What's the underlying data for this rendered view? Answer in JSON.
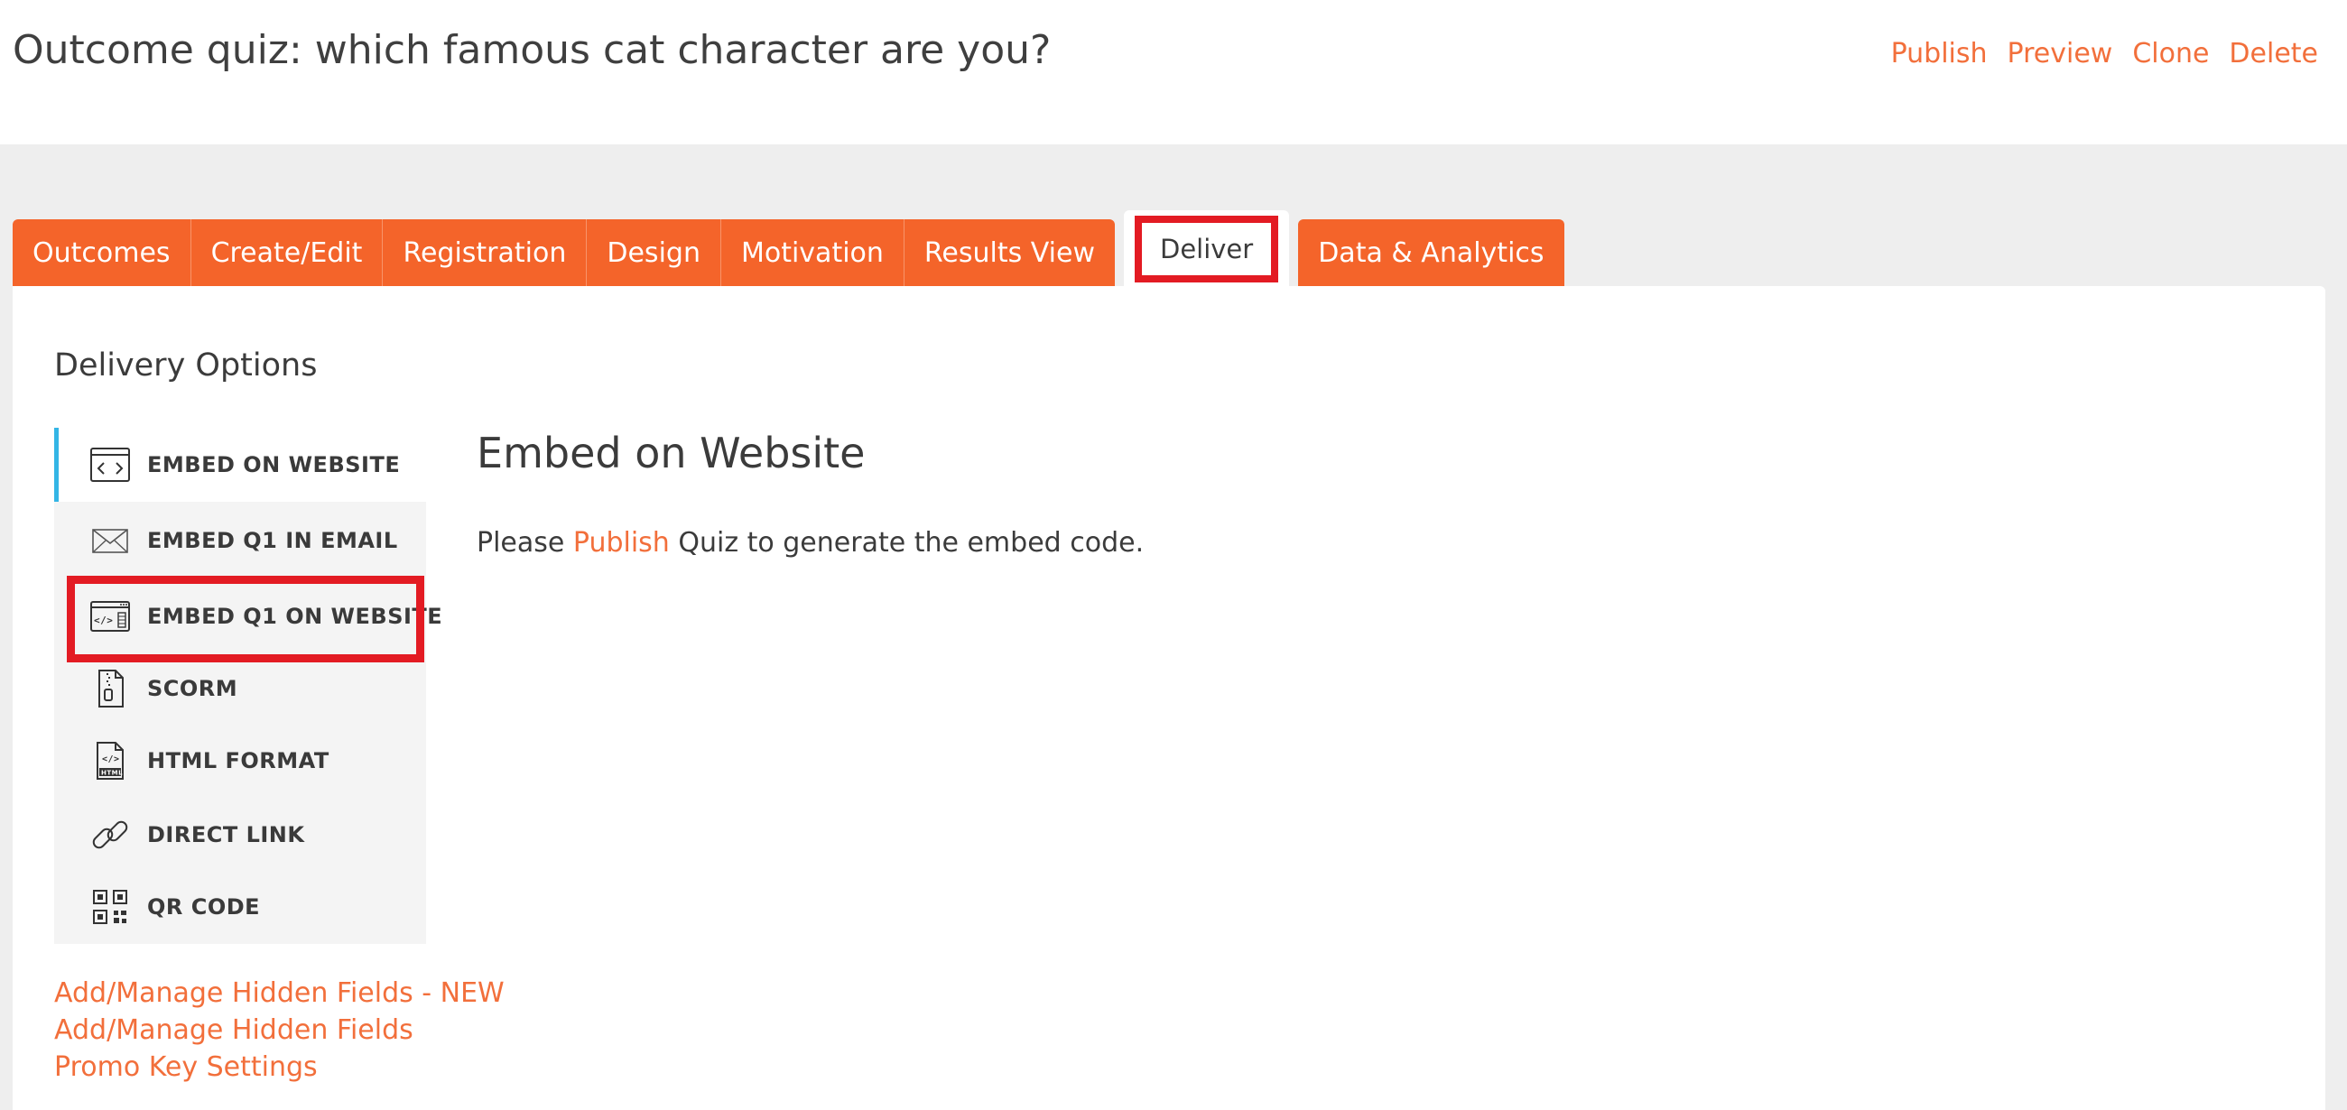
{
  "header": {
    "title": "Outcome quiz: which famous cat character are you?",
    "actions": [
      "Publish",
      "Preview",
      "Clone",
      "Delete"
    ]
  },
  "tabs": [
    {
      "label": "Outcomes",
      "active": false
    },
    {
      "label": "Create/Edit",
      "active": false
    },
    {
      "label": "Registration",
      "active": false
    },
    {
      "label": "Design",
      "active": false
    },
    {
      "label": "Motivation",
      "active": false
    },
    {
      "label": "Results View",
      "active": false
    },
    {
      "label": "Deliver",
      "active": true
    },
    {
      "label": "Data & Analytics",
      "active": false
    }
  ],
  "delivery": {
    "section_title": "Delivery Options",
    "menu": [
      {
        "label": "EMBED ON WEBSITE",
        "icon": "code-window-icon",
        "active": true
      },
      {
        "label": "EMBED Q1 IN EMAIL",
        "icon": "envelope-icon",
        "active": false
      },
      {
        "label": "EMBED Q1 ON WEBSITE",
        "icon": "browser-code-icon",
        "active": false,
        "highlighted": true
      },
      {
        "label": "SCORM",
        "icon": "zip-file-icon",
        "active": false
      },
      {
        "label": "HTML FORMAT",
        "icon": "html-file-icon",
        "active": false
      },
      {
        "label": "DIRECT LINK",
        "icon": "link-icon",
        "active": false
      },
      {
        "label": "QR CODE",
        "icon": "qr-code-icon",
        "active": false
      }
    ],
    "content": {
      "title": "Embed on Website",
      "text_before": "Please ",
      "link": "Publish",
      "text_after": " Quiz to generate the embed code."
    },
    "links": [
      "Add/Manage Hidden Fields - NEW",
      "Add/Manage Hidden Fields",
      "Promo Key Settings"
    ]
  },
  "colors": {
    "accent": "#f4642a",
    "link": "#f26f3b",
    "highlight": "#e31b23",
    "active_indicator": "#33b5e5"
  }
}
